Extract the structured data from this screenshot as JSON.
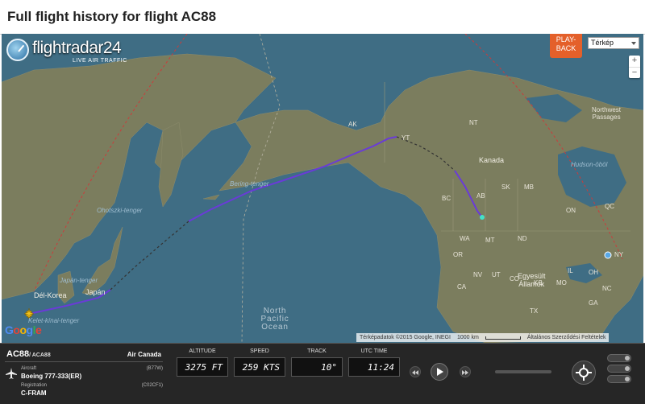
{
  "page": {
    "title": "Full flight history for flight AC88"
  },
  "map": {
    "brand": "flightradar24",
    "tagline": "LIVE AIR TRAFFIC",
    "playback_label": "PLAY-\nBACK",
    "maptype": {
      "selected": "Térkép"
    },
    "zoom": {
      "in": "+",
      "out": "−"
    },
    "labels": {
      "ohotszki": "Ohotszki-tenger",
      "bering": "Bering-tenger",
      "japan_tenger": "Japán-tenger",
      "del_korea": "Dél-Korea",
      "japan": "Japán",
      "kelet_kinai": "Kelet-kínai-tenger",
      "north_pacific_1": "North",
      "north_pacific_2": "Pacific",
      "north_pacific_3": "Ocean",
      "kanada": "Kanada",
      "northwest_1": "Northwest",
      "northwest_2": "Passages",
      "hudson": "Hudson-öböl",
      "egyesult_1": "Egyesült",
      "egyesult_2": "Államok",
      "yt": "YT",
      "nt": "NT",
      "ab": "AB",
      "bc": "BC",
      "sk": "SK",
      "mb": "MB",
      "ak": "AK",
      "wa": "WA",
      "or": "OR",
      "mt": "MT",
      "nd": "ND",
      "on": "ON",
      "qc": "QC",
      "ca": "CA",
      "nv": "NV",
      "ut": "UT",
      "co": "CO",
      "ks": "KS",
      "tx": "TX",
      "mo": "MO",
      "il": "IL",
      "oh": "OH",
      "ny": "NY",
      "nc": "NC",
      "ga": "GA"
    },
    "google": [
      "G",
      "o",
      "o",
      "g",
      "l",
      "e"
    ],
    "attribution": {
      "data": "Térképadatok ©2015 Google, INEGI",
      "scale": "1000 km",
      "terms": "Általános Szerződési Feltételek"
    }
  },
  "flight": {
    "callsign": "AC88",
    "callsign_alt": "/ ACA88",
    "airline": "Air Canada",
    "aircraft_label": "Aircraft",
    "aircraft_code": "(B77W)",
    "aircraft": "Boeing 777-333(ER)",
    "registration_label": "Registration",
    "registration_code": "(C02CF1)",
    "registration": "C-FRAM"
  },
  "gauges": [
    {
      "label": "ALTITUDE",
      "value": "3275 FT"
    },
    {
      "label": "SPEED",
      "value": "259 KTS"
    },
    {
      "label": "TRACK",
      "value": "10°"
    },
    {
      "label": "UTC TIME",
      "value": "11:24"
    }
  ],
  "colors": {
    "flight_track": "#6a3bd8",
    "gap_track": "#444444",
    "accent": "#e4602a",
    "ocean": "#3f6d84",
    "land": "#7a7b5c"
  }
}
